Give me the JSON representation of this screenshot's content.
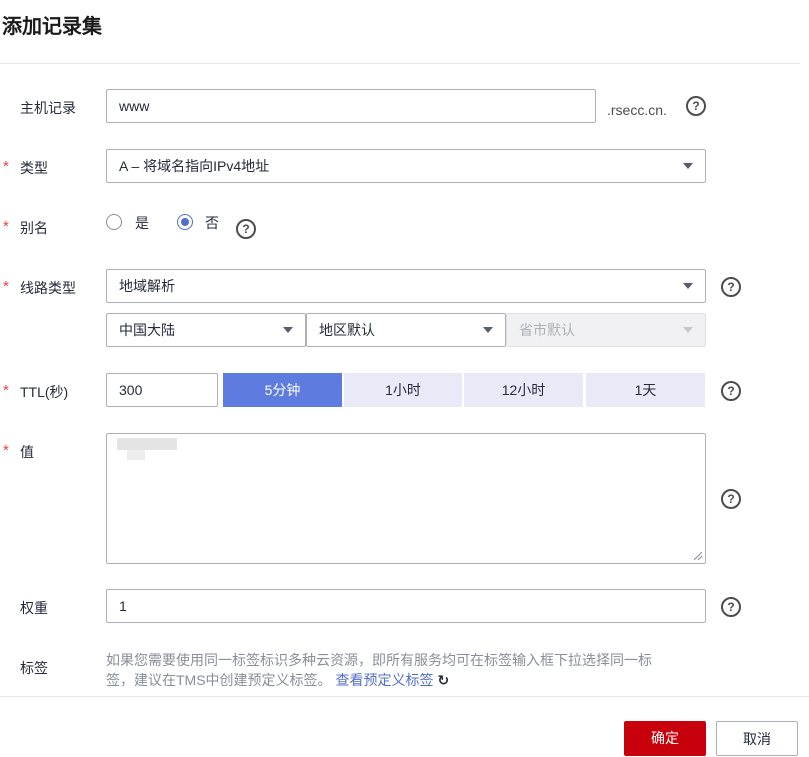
{
  "dialog": {
    "title": "添加记录集"
  },
  "host_record": {
    "label": "主机记录",
    "value": "www",
    "suffix": ".rsecc.cn."
  },
  "record_type": {
    "label": "类型",
    "value": "A – 将域名指向IPv4地址"
  },
  "alias": {
    "label": "别名",
    "options": [
      "是",
      "否"
    ],
    "selected": "否"
  },
  "line_type": {
    "label": "线路类型",
    "value": "地域解析",
    "region": "中国大陆",
    "area": "地区默认",
    "province": "省市默认"
  },
  "ttl": {
    "label": "TTL(秒)",
    "value": "300",
    "presets": [
      "5分钟",
      "1小时",
      "12小时",
      "1天"
    ],
    "selected": "5分钟"
  },
  "value_field": {
    "label": "值"
  },
  "weight": {
    "label": "权重",
    "value": "1"
  },
  "tags": {
    "label": "标签",
    "line1": "如果您需要使用同一标签标识多种云资源，即所有服务均可在标签输入框下拉选择同一标",
    "line2": "签，建议在TMS中创建预定义标签。",
    "link": "查看预定义标签"
  },
  "footer": {
    "confirm_label": "确定",
    "cancel_label": "取消"
  },
  "icons": {
    "help": "help-circle-icon",
    "refresh": "refresh-icon",
    "required": "required-asterisk-icon"
  },
  "colors": {
    "accent": "#5e7ce0",
    "primary_button": "#c7000b",
    "required": "#e54545",
    "link": "#526ecc"
  }
}
